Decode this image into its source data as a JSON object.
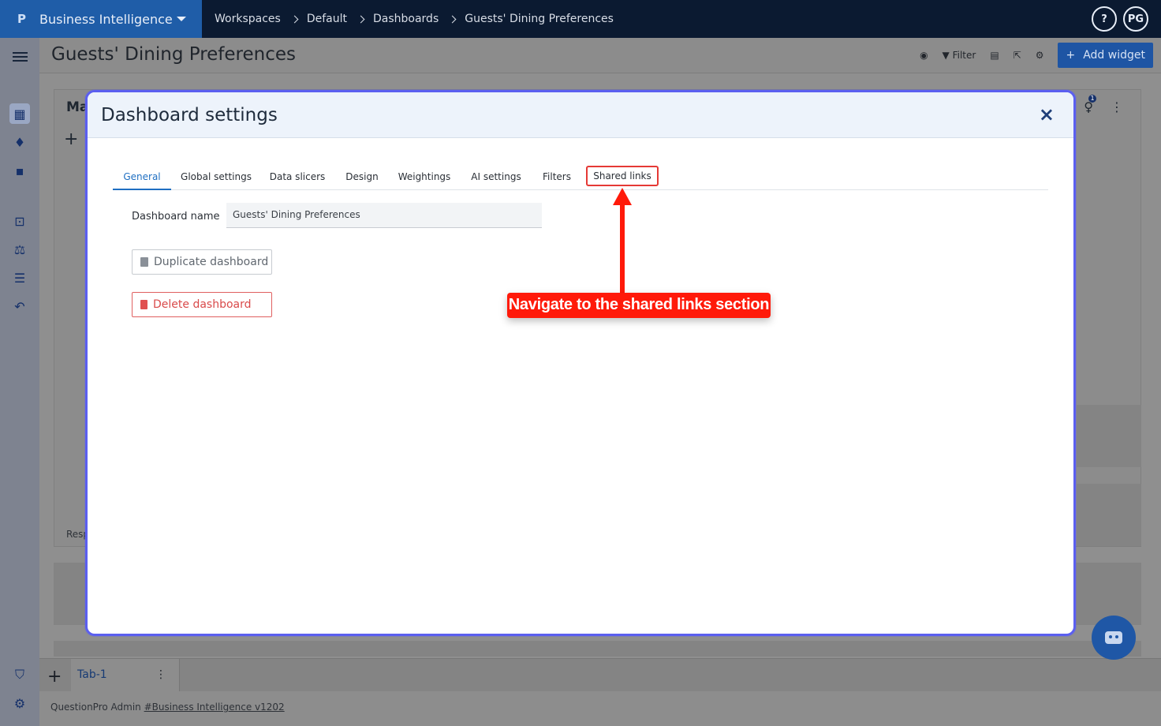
{
  "topbar": {
    "logo": "P",
    "app_name": "Business Intelligence",
    "breadcrumbs": [
      "Workspaces",
      "Default",
      "Dashboards",
      "Guests' Dining Preferences"
    ],
    "help": "?",
    "avatar_initials": "PG"
  },
  "header": {
    "title": "Guests' Dining Preferences",
    "filter_label": "Filter",
    "add_widget_label": "Add widget"
  },
  "background": {
    "widget_title_partial": "Ma",
    "widget_footer_partial": "Resp",
    "notification_count": "1"
  },
  "modal": {
    "title": "Dashboard settings",
    "close": "×",
    "tabs": [
      "General",
      "Global settings",
      "Data slicers",
      "Design",
      "Weightings",
      "AI settings",
      "Filters",
      "Shared links"
    ],
    "active_tab": "General",
    "highlighted_tab": "Shared links",
    "dashboard_name_label": "Dashboard name",
    "dashboard_name_value": "Guests' Dining Preferences",
    "duplicate_label": "Duplicate dashboard",
    "delete_label": "Delete dashboard"
  },
  "annotation": {
    "text": "Navigate to the shared links section",
    "color": "#ff1a0a"
  },
  "tabstrip": {
    "tab_label": "Tab-1"
  },
  "footer": {
    "prefix": "QuestionPro Admin ",
    "link": "#Business Intelligence v1202"
  },
  "colors": {
    "accent": "#1f6fc2",
    "modal_border": "#5b5ff0",
    "danger": "#d94a4a"
  }
}
